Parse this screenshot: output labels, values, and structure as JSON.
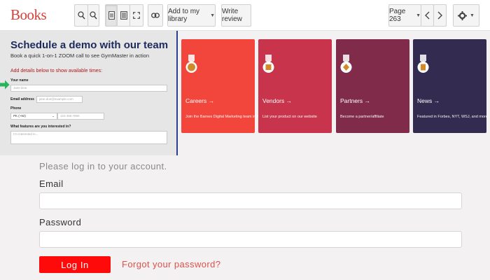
{
  "toolbar": {
    "brand": "Books",
    "add_to_library": "Add to my library",
    "write_review": "Write review",
    "page": "Page 263"
  },
  "icons": [
    "zoom-in-icon",
    "zoom-out-icon",
    "single-page-icon",
    "text-view-icon",
    "fullscreen-icon",
    "link-icon",
    "chevron-left-icon",
    "chevron-right-icon",
    "gear-icon"
  ],
  "demo": {
    "title": "Schedule a demo with our team",
    "subtitle": "Book a quick 1-on-1 ZOOM call to see GymMaster in action",
    "add_details": "Add details below to show available times:",
    "name_label": "Your name",
    "name_placeholder": "Jane Doe",
    "email_label": "Email address",
    "email_placeholder": "jane.doe@example.com",
    "phone_label": "Phone",
    "country_value": "PK (+92)",
    "phone_placeholder": "123 456 7890",
    "features_label": "What features are you interested in?",
    "features_placeholder": "I'm interested in..."
  },
  "cards": [
    {
      "title": "Careers →",
      "desc": "Join the Barnes Digital Marketing team in Austin.",
      "color": "#f2453c"
    },
    {
      "title": "Vendors →",
      "desc": "List your product on our website",
      "color": "#c7344b"
    },
    {
      "title": "Partners →",
      "desc": "Become a partner/affiliate",
      "color": "#7f2b49"
    },
    {
      "title": "News →",
      "desc": "Featured in Forbes, NYT, WSJ, and more",
      "color": "#342b50"
    }
  ],
  "login": {
    "message": "Please log in to your account.",
    "email_label": "Email",
    "password_label": "Password",
    "login_button": "Log In",
    "forgot_link": "Forgot your password?"
  },
  "colors": {
    "brand": "#d2413a",
    "login_button": "#ff0a0a",
    "link": "#e0504a",
    "demo_title": "#1d2a5c"
  }
}
